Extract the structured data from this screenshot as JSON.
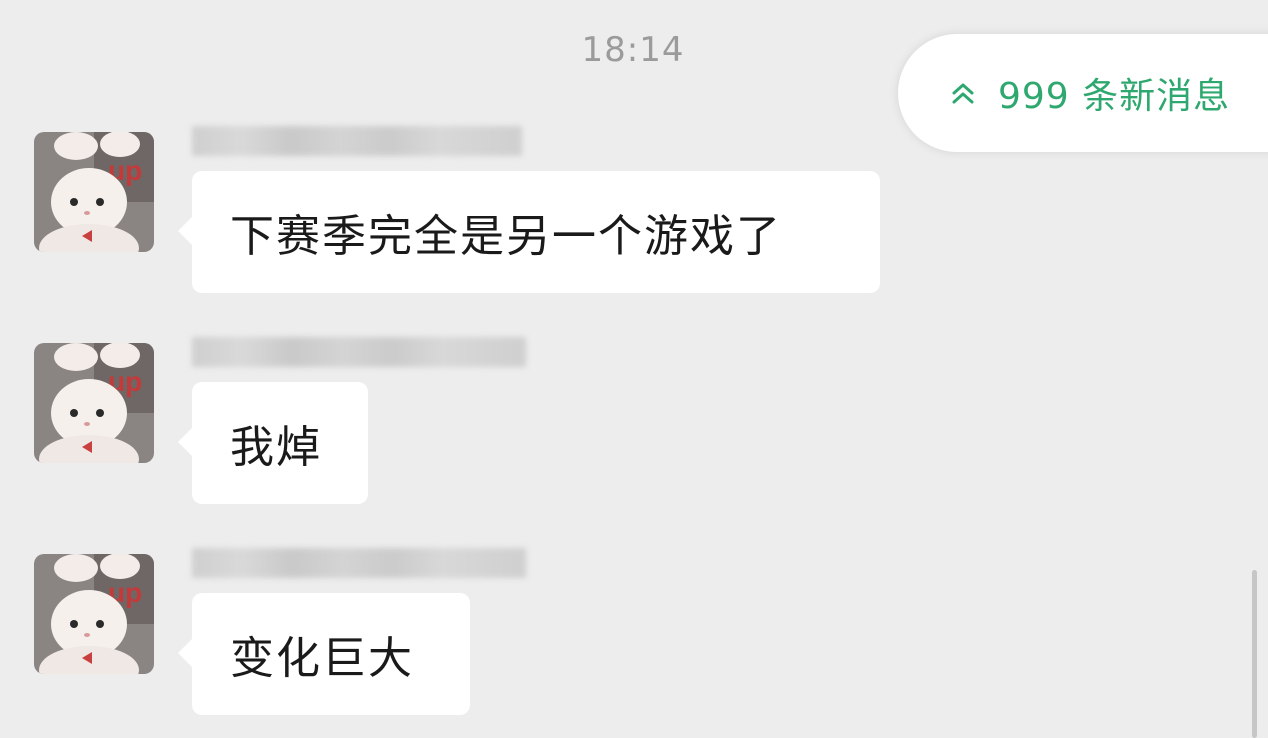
{
  "chat": {
    "timestamp": "18:14",
    "new_messages": {
      "label": "999 条新消息",
      "icon": "double-chevron-up-icon",
      "color": "#2fa870"
    },
    "messages": [
      {
        "text": "下赛季完全是另一个游戏了",
        "avatar": "white-cat-avatar",
        "sender_name_hidden": true
      },
      {
        "text": "我焯",
        "avatar": "white-cat-avatar",
        "sender_name_hidden": true
      },
      {
        "text": "变化巨大",
        "avatar": "white-cat-avatar",
        "sender_name_hidden": true
      }
    ]
  },
  "colors": {
    "background": "#ededed",
    "bubble": "#ffffff",
    "accent": "#2fa870"
  }
}
